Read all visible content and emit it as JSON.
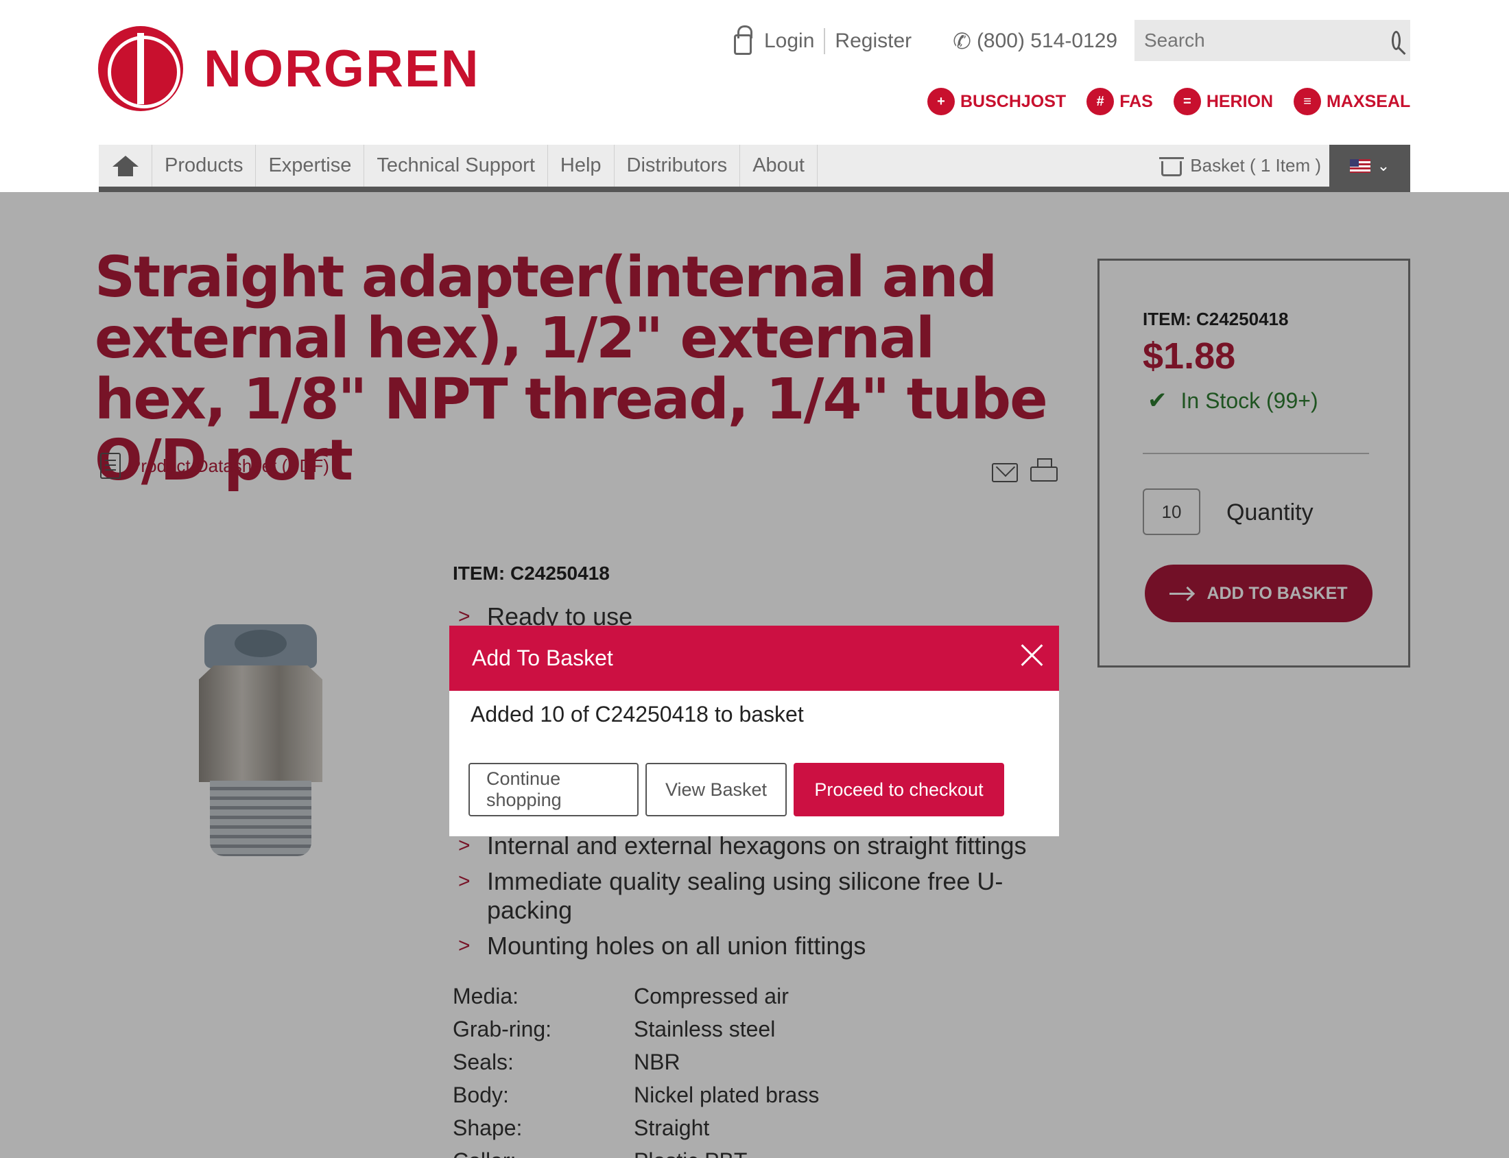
{
  "brand": {
    "name": "NORGREN"
  },
  "header": {
    "login": "Login",
    "register": "Register",
    "phone": "(800) 514-0129",
    "search_placeholder": "Search",
    "brands": [
      "BUSCHJOST",
      "FAS",
      "HERION",
      "MAXSEAL"
    ]
  },
  "nav": {
    "items": [
      "Products",
      "Expertise",
      "Technical Support",
      "Help",
      "Distributors",
      "About"
    ],
    "basket": "Basket ( 1 Item )"
  },
  "product": {
    "title": "Straight adapter(internal and external hex), 1/2\" external hex, 1/8\" NPT thread, 1/4\" tube O/D port",
    "datasheet": "Product Datasheet (PDF)",
    "item": "ITEM: C24250418",
    "bullets": [
      "Ready to use",
      "Internal and external hexagons on straight fittings",
      "Immediate quality sealing using silicone free U-packing",
      "Mounting holes on all union fittings"
    ],
    "props": [
      {
        "k": "Media:",
        "v": "Compressed air"
      },
      {
        "k": "Grab-ring:",
        "v": "Stainless steel"
      },
      {
        "k": "Seals:",
        "v": "NBR"
      },
      {
        "k": "Body:",
        "v": "Nickel plated brass"
      },
      {
        "k": "Shape:",
        "v": "Straight"
      },
      {
        "k": "Collar:",
        "v": "Plastic PBT"
      }
    ]
  },
  "sidebar": {
    "item": "ITEM: C24250418",
    "price": "$1.88",
    "stock": "In Stock (99+)",
    "quantity": "10",
    "quantity_label": "Quantity",
    "add_button": "ADD TO BASKET"
  },
  "modal": {
    "title": "Add To Basket",
    "message": "Added 10 of C24250418 to basket",
    "continue": "Continue shopping",
    "view": "View Basket",
    "checkout": "Proceed to checkout"
  },
  "colors": {
    "brand": "#c8102e",
    "accent": "#cc1042",
    "stock": "#2e7d32"
  }
}
